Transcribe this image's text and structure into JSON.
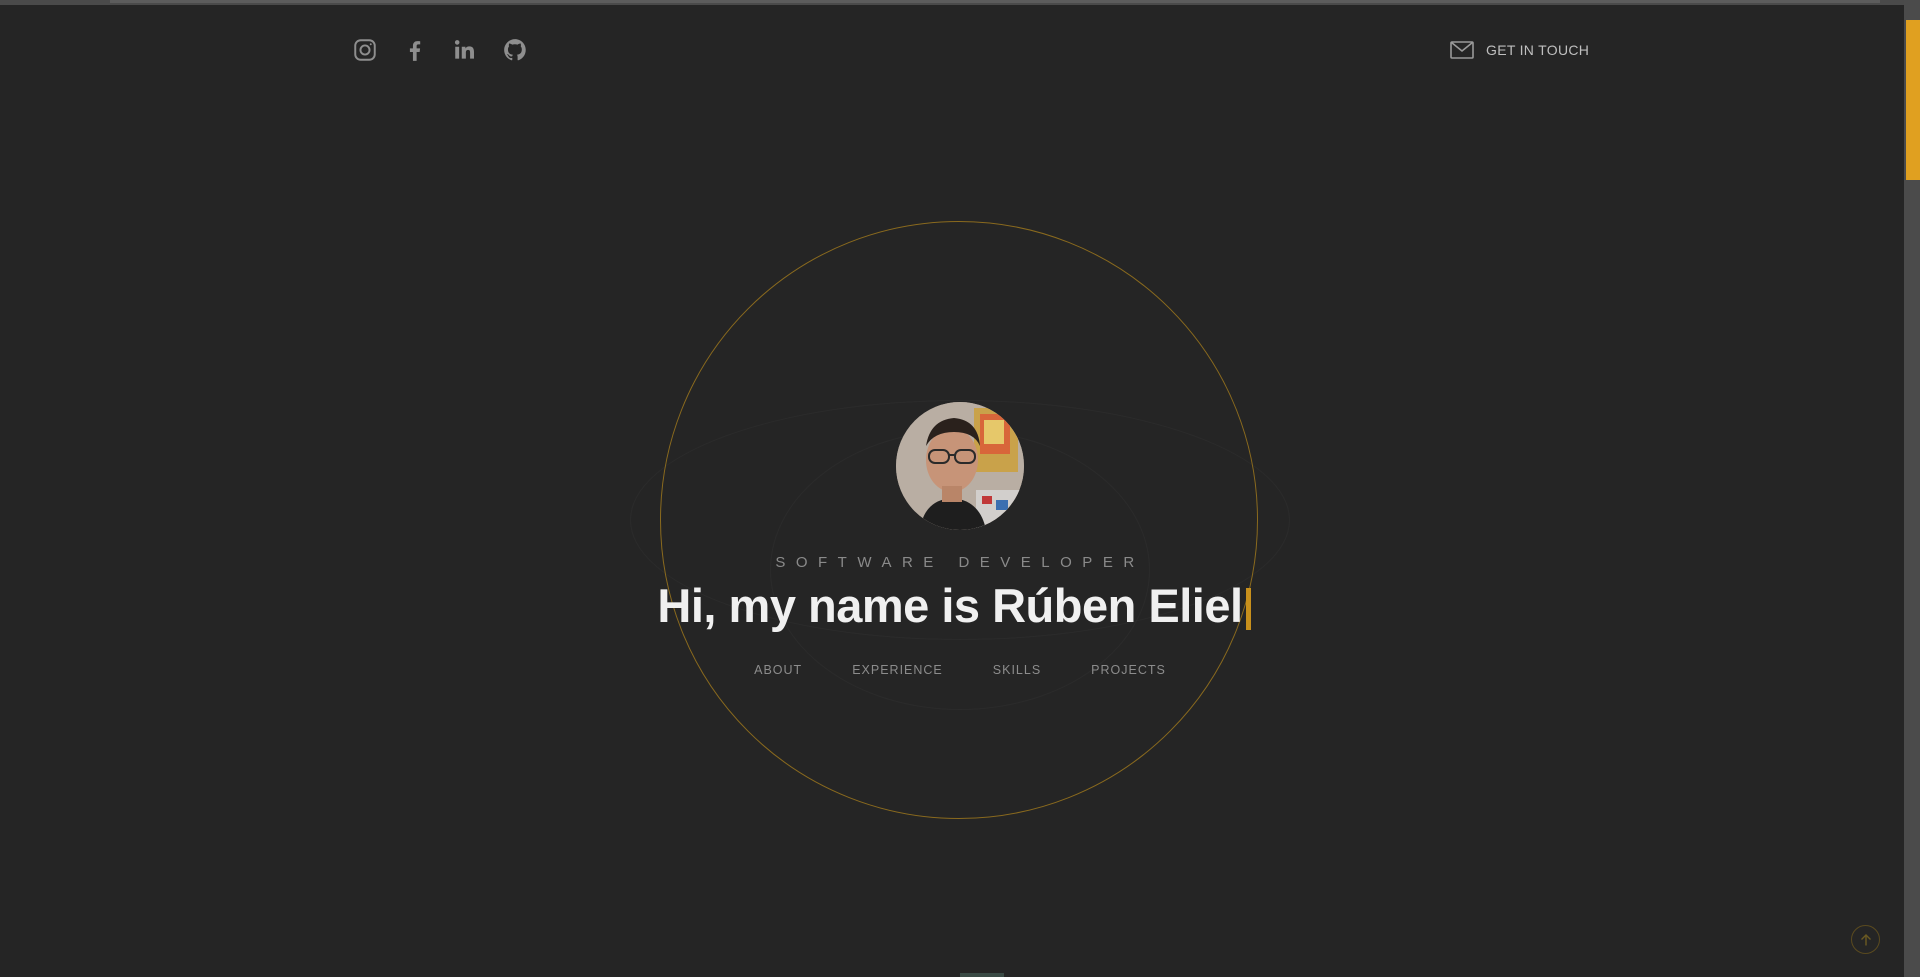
{
  "social": {
    "icons": [
      "instagram-icon",
      "facebook-icon",
      "linkedin-icon",
      "github-icon"
    ],
    "icon_color": "#8e8e8e"
  },
  "contact": {
    "label": "GET IN TOUCH",
    "icon": "mail-icon"
  },
  "hero": {
    "subtitle": "SOFTWARE DEVELOPER",
    "headline": "Hi, my name is Rúben Eliel",
    "accent_color": "#c8901c"
  },
  "nav": {
    "items": [
      "ABOUT",
      "EXPERIENCE",
      "SKILLS",
      "PROJECTS"
    ]
  },
  "scroll": {
    "back_to_top_icon": "arrow-up-icon"
  }
}
